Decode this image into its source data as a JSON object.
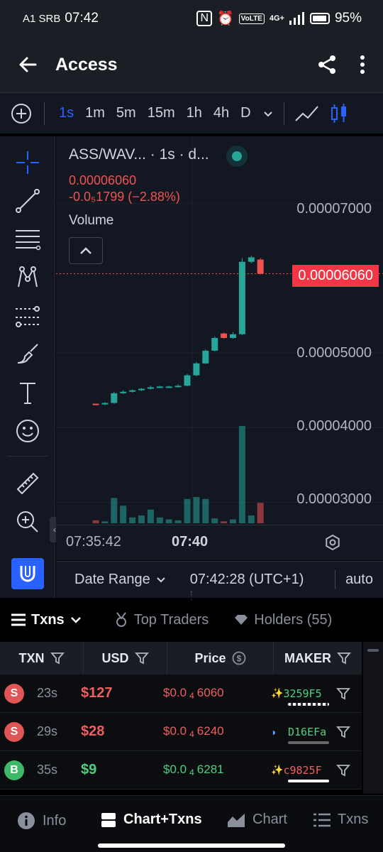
{
  "status_bar": {
    "carrier": "A1 SRB",
    "time": "07:42",
    "battery": "95%",
    "network": "4G+"
  },
  "app_bar": {
    "title": "Access",
    "back_icon": "arrow-left-icon",
    "share_icon": "share-icon",
    "more_icon": "more-vertical-icon"
  },
  "toolbar": {
    "intervals": [
      "1s",
      "1m",
      "5m",
      "15m",
      "1h",
      "4h",
      "D"
    ],
    "active_interval": "1s"
  },
  "chart": {
    "symbol": "ASS/WAV... · 1s · d...",
    "price": "0.00006060",
    "change": "-0.0₅1799 (−2.88%)",
    "volume_label": "Volume",
    "y_ticks": [
      "0.00007000",
      "0.00005000",
      "0.00004000",
      "0.00003000"
    ],
    "last_price_tag": "0.00006060",
    "x_ticks": [
      "07:35:42",
      "07:40"
    ],
    "up_color": "#26a69a",
    "down_color": "#ef5350"
  },
  "chart_data": {
    "type": "candlestick",
    "title": "ASS/WAV... · 1s · d...",
    "ylim": [
      2.7e-05,
      7.9e-05
    ],
    "y_ticks": [
      7e-05,
      5e-05,
      4e-05,
      3e-05
    ],
    "x_ticks": [
      "07:35:42",
      "07:40"
    ],
    "candles": [
      {
        "o": 4.32e-05,
        "h": 4.32e-05,
        "l": 4.3e-05,
        "c": 4.31e-05
      },
      {
        "o": 4.31e-05,
        "h": 4.34e-05,
        "l": 4.3e-05,
        "c": 4.33e-05
      },
      {
        "o": 4.33e-05,
        "h": 4.48e-05,
        "l": 4.32e-05,
        "c": 4.46e-05
      },
      {
        "o": 4.46e-05,
        "h": 4.5e-05,
        "l": 4.45e-05,
        "c": 4.48e-05
      },
      {
        "o": 4.48e-05,
        "h": 4.51e-05,
        "l": 4.47e-05,
        "c": 4.5e-05
      },
      {
        "o": 4.5e-05,
        "h": 4.53e-05,
        "l": 4.49e-05,
        "c": 4.52e-05
      },
      {
        "o": 4.52e-05,
        "h": 4.56e-05,
        "l": 4.51e-05,
        "c": 4.54e-05
      },
      {
        "o": 4.54e-05,
        "h": 4.56e-05,
        "l": 4.53e-05,
        "c": 4.55e-05
      },
      {
        "o": 4.55e-05,
        "h": 4.56e-05,
        "l": 4.54e-05,
        "c": 4.55e-05
      },
      {
        "o": 4.55e-05,
        "h": 4.58e-05,
        "l": 4.54e-05,
        "c": 4.56e-05
      },
      {
        "o": 4.56e-05,
        "h": 4.72e-05,
        "l": 4.55e-05,
        "c": 4.7e-05
      },
      {
        "o": 4.7e-05,
        "h": 4.88e-05,
        "l": 4.69e-05,
        "c": 4.86e-05
      },
      {
        "o": 4.86e-05,
        "h": 5.05e-05,
        "l": 4.85e-05,
        "c": 5.03e-05
      },
      {
        "o": 5.03e-05,
        "h": 5.22e-05,
        "l": 5.02e-05,
        "c": 5.2e-05
      },
      {
        "o": 5.26e-05,
        "h": 5.27e-05,
        "l": 5.19e-05,
        "c": 5.2e-05
      },
      {
        "o": 5.2e-05,
        "h": 5.28e-05,
        "l": 5.19e-05,
        "c": 5.25e-05
      },
      {
        "o": 5.25e-05,
        "h": 6.27e-05,
        "l": 5.24e-05,
        "c": 6.22e-05
      },
      {
        "o": 6.22e-05,
        "h": 6.3e-05,
        "l": 6.2e-05,
        "c": 6.28e-05
      },
      {
        "o": 6.25e-05,
        "h": 6.27e-05,
        "l": 6.05e-05,
        "c": 6.06e-05
      }
    ],
    "volumes": [
      0.03,
      0.02,
      0.26,
      0.18,
      0.06,
      0.08,
      0.14,
      0.06,
      0.04,
      0.03,
      0.25,
      0.27,
      0.25,
      0.05,
      0.02,
      0.04,
      1.0,
      0.08,
      0.21
    ]
  },
  "date_bar": {
    "date_range": "Date Range",
    "time": "07:42:28 (UTC+1)",
    "auto": "auto"
  },
  "tabs": {
    "txns": "Txns",
    "top_traders": "Top Traders",
    "holders": "Holders (55)"
  },
  "table": {
    "headers": [
      "TXN",
      "USD",
      "Price",
      "MAKER"
    ],
    "rows": [
      {
        "type": "S",
        "age": "23s",
        "usd": "$127",
        "price_pre": "$0.0",
        "price_sub": "4",
        "price_post": "6060",
        "maker": "3259F5",
        "maker_color": "#4fd07f",
        "side": "sell"
      },
      {
        "type": "S",
        "age": "29s",
        "usd": "$28",
        "price_pre": "$0.0",
        "price_sub": "4",
        "price_post": "6240",
        "maker": "D16EFa",
        "maker_color": "#4fd07f",
        "side": "sell"
      },
      {
        "type": "B",
        "age": "35s",
        "usd": "$9",
        "price_pre": "$0.0",
        "price_sub": "4",
        "price_post": "6281",
        "maker": "c9825F",
        "maker_color": "#ef5f5f",
        "side": "buy"
      }
    ]
  },
  "bottom_nav": {
    "items": [
      "Info",
      "Chart+Txns",
      "Chart",
      "Txns"
    ],
    "active": "Chart+Txns"
  }
}
